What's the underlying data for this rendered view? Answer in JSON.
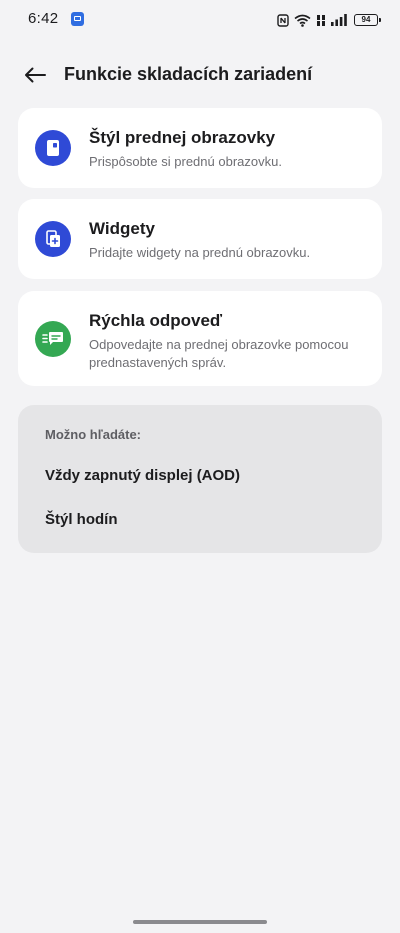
{
  "status_bar": {
    "time": "6:42",
    "battery": "94"
  },
  "header": {
    "title": "Funkcie skladacích zariadení"
  },
  "items": [
    {
      "title": "Štýl prednej obrazovky",
      "description": "Prispôsobte si prednú obrazovku.",
      "icon": "front-screen-icon",
      "color": "#2f4ad6"
    },
    {
      "title": "Widgety",
      "description": "Pridajte widgety na prednú obrazovku.",
      "icon": "widget-icon",
      "color": "#2f4ad6"
    },
    {
      "title": "Rýchla odpoveď",
      "description": "Odpovedajte na prednej obrazovke pomocou prednastavených správ.",
      "icon": "message-icon",
      "color": "#34a853"
    }
  ],
  "suggestions": {
    "label": "Možno hľadáte:",
    "links": [
      "Vždy zapnutý displej (AOD)",
      "Štýl hodín"
    ]
  }
}
